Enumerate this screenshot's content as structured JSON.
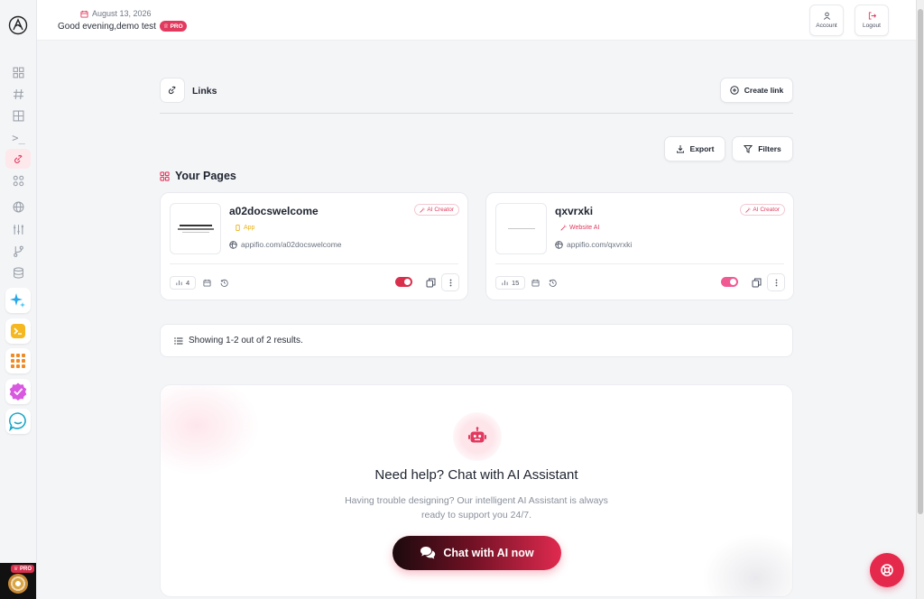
{
  "header": {
    "date": "August 13, 2026",
    "greeting": "Good evening,demo test",
    "pro_badge": "♕ PRO",
    "account_label": "Account",
    "logout_label": "Logout"
  },
  "sidebar": {
    "avatar_pro_badge": "♕ PRO",
    "items": [
      {
        "icon": "dashboard-grid-icon"
      },
      {
        "icon": "hash-icon"
      },
      {
        "icon": "table-grid-icon"
      },
      {
        "icon": "terminal-icon",
        "glyph": ">_"
      },
      {
        "icon": "link-icon",
        "active": true
      },
      {
        "icon": "widgets-icon"
      },
      {
        "icon": "globe-icon"
      },
      {
        "icon": "sliders-icon"
      },
      {
        "icon": "git-branch-icon"
      },
      {
        "icon": "database-icon"
      }
    ],
    "apps": [
      "ai-sparkle-app-icon",
      "terminal-app-icon",
      "grid-app-icon",
      "check-badge-app-icon",
      "chat-app-icon"
    ]
  },
  "page": {
    "title": "Links",
    "create_label": "Create link",
    "export_label": "Export",
    "filters_label": "Filters",
    "section_title": "Your Pages"
  },
  "cards": [
    {
      "title": "a02docswelcome",
      "type": "App",
      "type_color": "#e9b21a",
      "url": "appifio.com/a02docswelcome",
      "badge": "AI Creator",
      "views": "4",
      "toggle_color": "#d92f4d",
      "enabled": true
    },
    {
      "title": "qxvrxki",
      "type": "Website AI",
      "type_color": "#e23a5e",
      "url": "appifio.com/qxvrxki",
      "badge": "AI Creator",
      "views": "15",
      "toggle_color": "#ef5a93",
      "enabled": true
    }
  ],
  "results": {
    "text": "Showing 1-2 out of 2 results."
  },
  "help": {
    "title": "Need help? Chat with AI Assistant",
    "description": "Having trouble designing? Our intelligent AI Assistant is always ready to support you 24/7.",
    "button_label": "Chat with AI now"
  },
  "colors": {
    "accent": "#e4294d",
    "background": "#f4f5f7"
  }
}
